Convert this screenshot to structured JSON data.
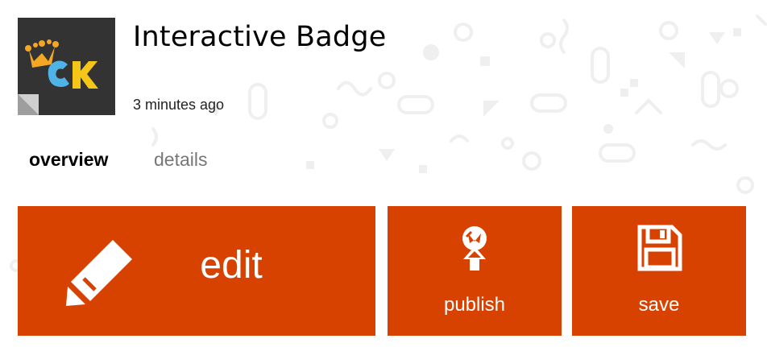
{
  "project": {
    "title": "Interactive Badge",
    "updated": "3 minutes ago",
    "logo_text": "CK"
  },
  "tabs": [
    {
      "label": "overview",
      "active": true
    },
    {
      "label": "details",
      "active": false
    }
  ],
  "actions": {
    "edit_label": "edit",
    "publish_label": "publish",
    "save_label": "save"
  },
  "icons": {
    "edit": "pencil-icon",
    "publish": "publish-icon",
    "save": "save-icon"
  },
  "colors": {
    "accent": "#D74200",
    "logo_bg": "#333333",
    "crown": "#F5A623",
    "logo_c": "#4FB3E8",
    "logo_k": "#F5C518",
    "tab_inactive": "#777777"
  }
}
